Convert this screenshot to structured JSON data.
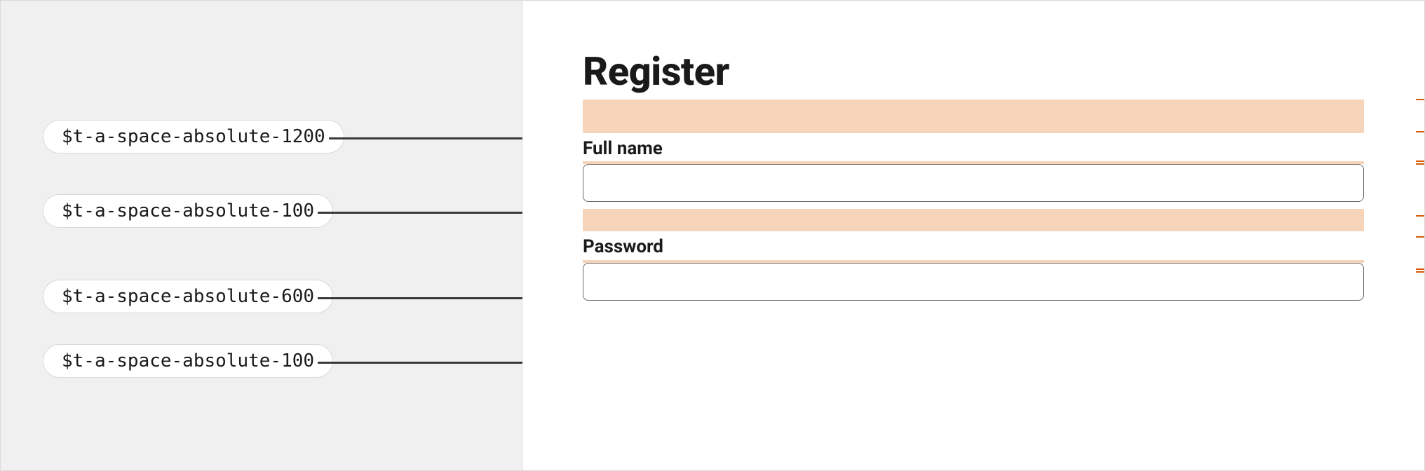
{
  "heading": "Register",
  "fields": {
    "fullname_label": "Full name",
    "password_label": "Password"
  },
  "tokens": {
    "t1": "$t-a-space-absolute-1200",
    "t2": "$t-a-space-absolute-100",
    "t3": "$t-a-space-absolute-600",
    "t4": "$t-a-space-absolute-100"
  },
  "pixels": {
    "p48": "48px",
    "p4a": "4px",
    "p32": "32px",
    "p4b": "4px"
  }
}
